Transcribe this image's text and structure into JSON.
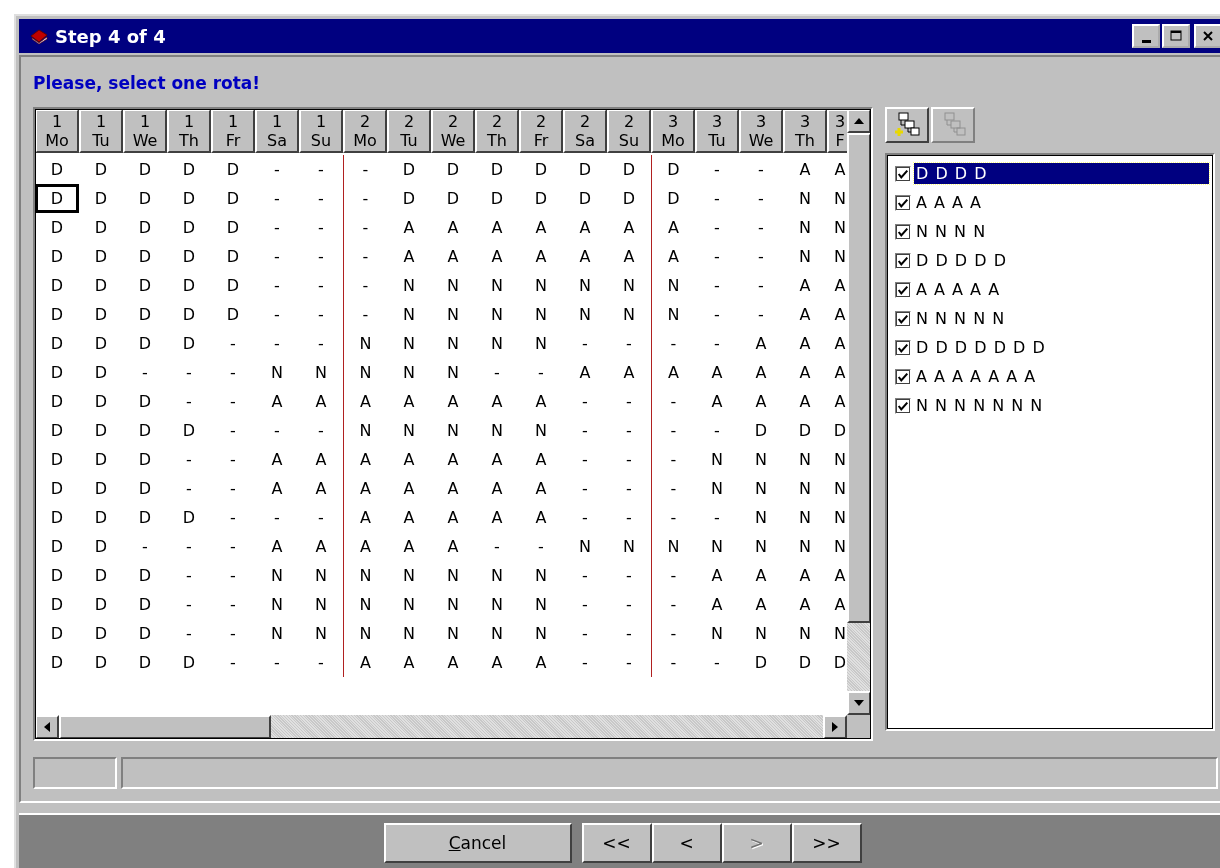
{
  "window": {
    "title": "Step 4 of 4"
  },
  "prompt": "Please, select one rota!",
  "columns": [
    {
      "day": "1",
      "weekday": "Mo",
      "focused": true
    },
    {
      "day": "1",
      "weekday": "Tu",
      "focused": false
    },
    {
      "day": "1",
      "weekday": "We",
      "focused": false
    },
    {
      "day": "1",
      "weekday": "Th",
      "focused": false
    },
    {
      "day": "1",
      "weekday": "Fr",
      "focused": false
    },
    {
      "day": "1",
      "weekday": "Sa",
      "focused": false
    },
    {
      "day": "1",
      "weekday": "Su",
      "focused": false
    },
    {
      "day": "2",
      "weekday": "Mo",
      "focused": false
    },
    {
      "day": "2",
      "weekday": "Tu",
      "focused": false
    },
    {
      "day": "2",
      "weekday": "We",
      "focused": false
    },
    {
      "day": "2",
      "weekday": "Th",
      "focused": false
    },
    {
      "day": "2",
      "weekday": "Fr",
      "focused": false
    },
    {
      "day": "2",
      "weekday": "Sa",
      "focused": false
    },
    {
      "day": "2",
      "weekday": "Su",
      "focused": false
    },
    {
      "day": "3",
      "weekday": "Mo",
      "focused": false
    },
    {
      "day": "3",
      "weekday": "Tu",
      "focused": false
    },
    {
      "day": "3",
      "weekday": "We",
      "focused": false
    },
    {
      "day": "3",
      "weekday": "Th",
      "focused": false
    },
    {
      "day": "3",
      "weekday": "F",
      "focused": false
    }
  ],
  "rows": [
    {
      "focused": false,
      "cells": [
        "D",
        "D",
        "D",
        "D",
        "D",
        "-",
        "-",
        "-",
        "D",
        "D",
        "D",
        "D",
        "D",
        "D",
        "D",
        "-",
        "-",
        "A",
        "A"
      ]
    },
    {
      "focused": true,
      "cells": [
        "D",
        "D",
        "D",
        "D",
        "D",
        "-",
        "-",
        "-",
        "D",
        "D",
        "D",
        "D",
        "D",
        "D",
        "D",
        "-",
        "-",
        "N",
        "N"
      ]
    },
    {
      "focused": false,
      "cells": [
        "D",
        "D",
        "D",
        "D",
        "D",
        "-",
        "-",
        "-",
        "A",
        "A",
        "A",
        "A",
        "A",
        "A",
        "A",
        "-",
        "-",
        "N",
        "N"
      ]
    },
    {
      "focused": false,
      "cells": [
        "D",
        "D",
        "D",
        "D",
        "D",
        "-",
        "-",
        "-",
        "A",
        "A",
        "A",
        "A",
        "A",
        "A",
        "A",
        "-",
        "-",
        "N",
        "N"
      ]
    },
    {
      "focused": false,
      "cells": [
        "D",
        "D",
        "D",
        "D",
        "D",
        "-",
        "-",
        "-",
        "N",
        "N",
        "N",
        "N",
        "N",
        "N",
        "N",
        "-",
        "-",
        "A",
        "A"
      ]
    },
    {
      "focused": false,
      "cells": [
        "D",
        "D",
        "D",
        "D",
        "D",
        "-",
        "-",
        "-",
        "N",
        "N",
        "N",
        "N",
        "N",
        "N",
        "N",
        "-",
        "-",
        "A",
        "A"
      ]
    },
    {
      "focused": false,
      "cells": [
        "D",
        "D",
        "D",
        "D",
        "-",
        "-",
        "-",
        "N",
        "N",
        "N",
        "N",
        "N",
        "-",
        "-",
        "-",
        "-",
        "A",
        "A",
        "A"
      ]
    },
    {
      "focused": false,
      "cells": [
        "D",
        "D",
        "-",
        "-",
        "-",
        "N",
        "N",
        "N",
        "N",
        "N",
        "-",
        "-",
        "A",
        "A",
        "A",
        "A",
        "A",
        "A",
        "A"
      ]
    },
    {
      "focused": false,
      "cells": [
        "D",
        "D",
        "D",
        "-",
        "-",
        "A",
        "A",
        "A",
        "A",
        "A",
        "A",
        "A",
        "-",
        "-",
        "-",
        "A",
        "A",
        "A",
        "A"
      ]
    },
    {
      "focused": false,
      "cells": [
        "D",
        "D",
        "D",
        "D",
        "-",
        "-",
        "-",
        "N",
        "N",
        "N",
        "N",
        "N",
        "-",
        "-",
        "-",
        "-",
        "D",
        "D",
        "D"
      ]
    },
    {
      "focused": false,
      "cells": [
        "D",
        "D",
        "D",
        "-",
        "-",
        "A",
        "A",
        "A",
        "A",
        "A",
        "A",
        "A",
        "-",
        "-",
        "-",
        "N",
        "N",
        "N",
        "N"
      ]
    },
    {
      "focused": false,
      "cells": [
        "D",
        "D",
        "D",
        "-",
        "-",
        "A",
        "A",
        "A",
        "A",
        "A",
        "A",
        "A",
        "-",
        "-",
        "-",
        "N",
        "N",
        "N",
        "N"
      ]
    },
    {
      "focused": false,
      "cells": [
        "D",
        "D",
        "D",
        "D",
        "-",
        "-",
        "-",
        "A",
        "A",
        "A",
        "A",
        "A",
        "-",
        "-",
        "-",
        "-",
        "N",
        "N",
        "N"
      ]
    },
    {
      "focused": false,
      "cells": [
        "D",
        "D",
        "-",
        "-",
        "-",
        "A",
        "A",
        "A",
        "A",
        "A",
        "-",
        "-",
        "N",
        "N",
        "N",
        "N",
        "N",
        "N",
        "N"
      ]
    },
    {
      "focused": false,
      "cells": [
        "D",
        "D",
        "D",
        "-",
        "-",
        "N",
        "N",
        "N",
        "N",
        "N",
        "N",
        "N",
        "-",
        "-",
        "-",
        "A",
        "A",
        "A",
        "A"
      ]
    },
    {
      "focused": false,
      "cells": [
        "D",
        "D",
        "D",
        "-",
        "-",
        "N",
        "N",
        "N",
        "N",
        "N",
        "N",
        "N",
        "-",
        "-",
        "-",
        "A",
        "A",
        "A",
        "A"
      ]
    },
    {
      "focused": false,
      "cells": [
        "D",
        "D",
        "D",
        "-",
        "-",
        "N",
        "N",
        "N",
        "N",
        "N",
        "N",
        "N",
        "-",
        "-",
        "-",
        "N",
        "N",
        "N",
        "N"
      ]
    },
    {
      "focused": false,
      "cells": [
        "D",
        "D",
        "D",
        "D",
        "-",
        "-",
        "-",
        "A",
        "A",
        "A",
        "A",
        "A",
        "-",
        "-",
        "-",
        "-",
        "D",
        "D",
        "D"
      ]
    }
  ],
  "toolbar": [
    {
      "kind": "add",
      "disabled": false
    },
    {
      "kind": "remove",
      "disabled": true
    }
  ],
  "rotas": [
    {
      "label": "D D D D",
      "checked": true,
      "selected": true
    },
    {
      "label": "A A A A",
      "checked": true,
      "selected": false
    },
    {
      "label": "N N N N",
      "checked": true,
      "selected": false
    },
    {
      "label": "D D D D D",
      "checked": true,
      "selected": false
    },
    {
      "label": "A A A A A",
      "checked": true,
      "selected": false
    },
    {
      "label": "N N N N N",
      "checked": true,
      "selected": false
    },
    {
      "label": "D D D D D D D",
      "checked": true,
      "selected": false
    },
    {
      "label": "A A A A A A A",
      "checked": true,
      "selected": false
    },
    {
      "label": "N N N N N N N",
      "checked": true,
      "selected": false
    }
  ],
  "buttons": [
    {
      "label": "Cancel",
      "kind": "wide",
      "disabled": false
    },
    {
      "label": "<<",
      "kind": "nav",
      "disabled": false
    },
    {
      "label": "<",
      "kind": "nav",
      "disabled": false
    },
    {
      "label": ">",
      "kind": "nav",
      "disabled": true
    },
    {
      "label": ">>",
      "kind": "nav",
      "disabled": false
    }
  ]
}
